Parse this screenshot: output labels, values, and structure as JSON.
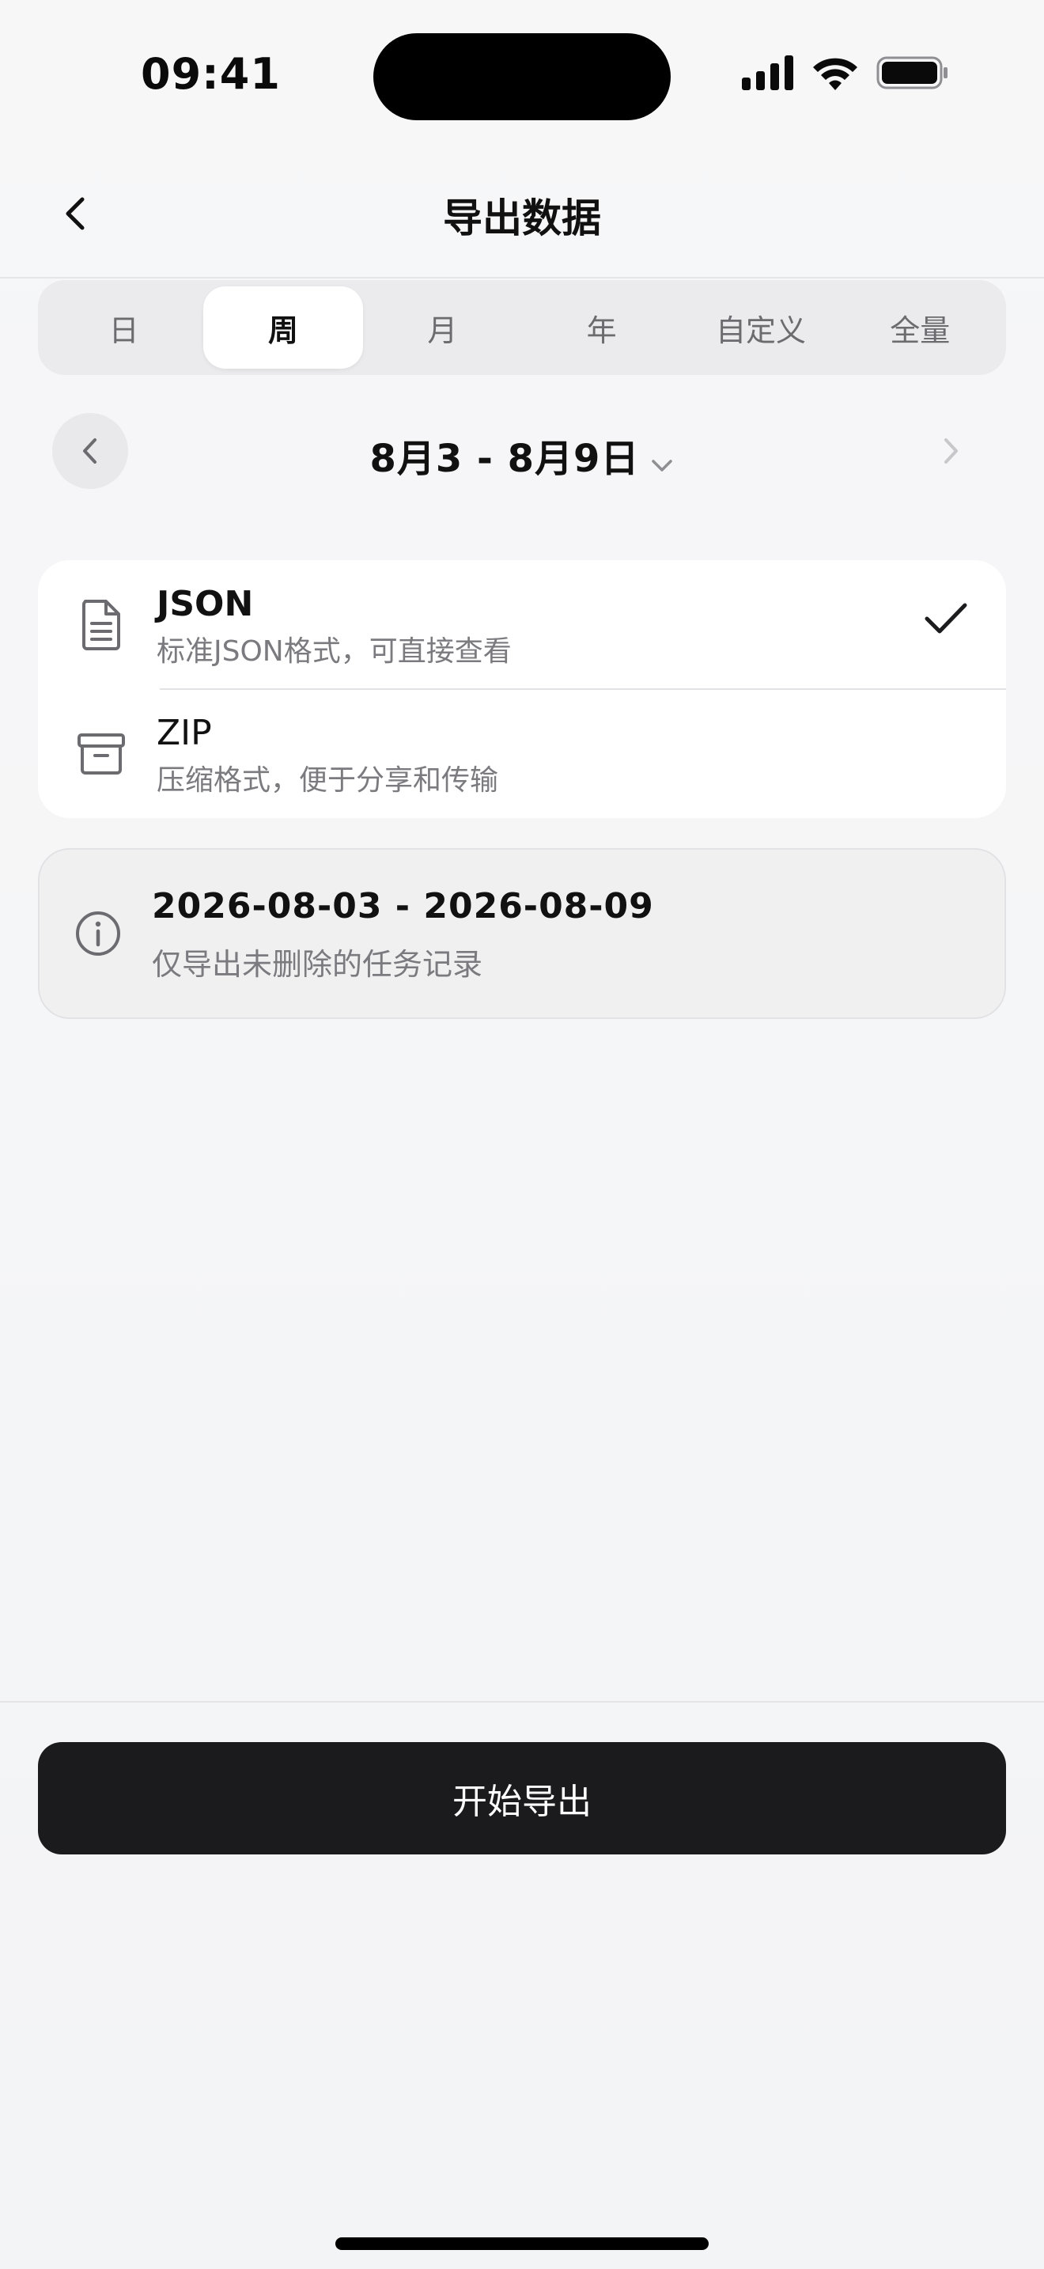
{
  "status_bar": {
    "time": "09:41"
  },
  "nav": {
    "title": "导出数据"
  },
  "segments": [
    {
      "label": "日",
      "active": false
    },
    {
      "label": "周",
      "active": true
    },
    {
      "label": "月",
      "active": false
    },
    {
      "label": "年",
      "active": false
    },
    {
      "label": "自定义",
      "active": false
    },
    {
      "label": "全量",
      "active": false
    }
  ],
  "date_range": {
    "label": "8月3 - 8月9日"
  },
  "formats": [
    {
      "title": "JSON",
      "description": "标准JSON格式，可直接查看",
      "selected": true,
      "icon": "document-icon"
    },
    {
      "title": "ZIP",
      "description": "压缩格式，便于分享和传输",
      "selected": false,
      "icon": "archive-icon"
    }
  ],
  "info": {
    "range": "2026-08-03 - 2026-08-09",
    "note": "仅导出未删除的任务记录",
    "icon": "info-icon"
  },
  "action": {
    "export_label": "开始导出"
  },
  "colors": {
    "accent": "#1b1b1d",
    "background": "#f3f4f6",
    "card": "#ffffff"
  }
}
